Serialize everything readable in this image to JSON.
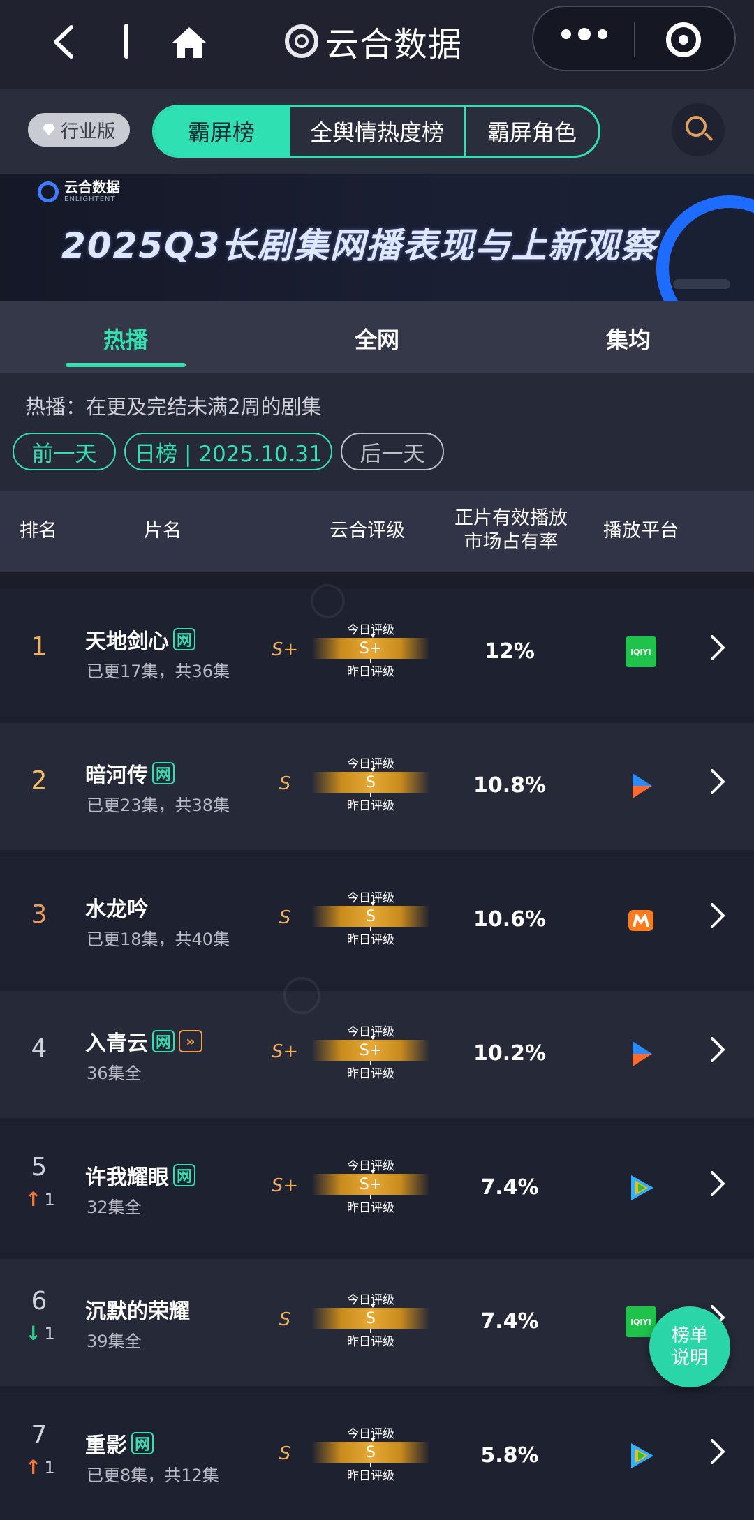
{
  "nav": {
    "title": "云合数据"
  },
  "category": {
    "industry_label": "行业版",
    "tabs": [
      "霸屏榜",
      "全舆情热度榜",
      "霸屏角色"
    ]
  },
  "banner": {
    "brand_cn": "云合数据",
    "brand_en": "ENLIGHTENT",
    "title": "2025Q3长剧集网播表现与上新观察"
  },
  "subtabs": [
    "热播",
    "全网",
    "集均"
  ],
  "filter": {
    "description": "热播：在更及完结未满2周的剧集",
    "prev": "前一天",
    "date": "日榜 | 2025.10.31",
    "next": "后一天"
  },
  "table": {
    "headers": {
      "rank": "排名",
      "name": "片名",
      "grade": "云合评级",
      "share_line1": "正片有效播放",
      "share_line2": "市场占有率",
      "platform": "播放平台"
    },
    "grade_today_label": "今日评级",
    "grade_yesterday_label": "昨日评级",
    "net_badge": "网",
    "rows": [
      {
        "rank": "1",
        "name": "天地剑心",
        "eps": "已更17集，共36集",
        "grade": "S+",
        "bar_grade": "S+",
        "share": "12%",
        "platform": "iqiyi"
      },
      {
        "rank": "2",
        "name": "暗河传",
        "eps": "已更23集，共38集",
        "grade": "S",
        "bar_grade": "S",
        "share": "10.8%",
        "platform": "youku"
      },
      {
        "rank": "3",
        "name": "水龙吟",
        "eps": "已更18集，共40集",
        "grade": "S",
        "bar_grade": "S",
        "share": "10.6%",
        "platform": "mango"
      },
      {
        "rank": "4",
        "name": "入青云",
        "eps": "36集全",
        "grade": "S+",
        "bar_grade": "S+",
        "share": "10.2%",
        "platform": "youku"
      },
      {
        "rank": "5",
        "trend": "up",
        "trend_num": "1",
        "name": "许我耀眼",
        "eps": "32集全",
        "grade": "S+",
        "bar_grade": "S+",
        "share": "7.4%",
        "platform": "tencent"
      },
      {
        "rank": "6",
        "trend": "down",
        "trend_num": "1",
        "name": "沉默的荣耀",
        "eps": "39集全",
        "grade": "S",
        "bar_grade": "S",
        "share": "7.4%",
        "platform": "iqiyi"
      },
      {
        "rank": "7",
        "trend": "up",
        "trend_num": "1",
        "name": "重影",
        "eps": "已更8集，共12集",
        "grade": "S",
        "bar_grade": "S",
        "share": "5.8%",
        "platform": "tencent"
      }
    ]
  },
  "fab": {
    "line1": "榜单",
    "line2": "说明"
  },
  "colors": {
    "accent": "#2ee0b2",
    "rank_gold": "#f0b060",
    "background": "#1c1f2e"
  },
  "icons": [
    "back-icon",
    "home-icon",
    "more-icon",
    "target-icon",
    "search-icon",
    "diamond-icon",
    "chevron-right-icon"
  ]
}
